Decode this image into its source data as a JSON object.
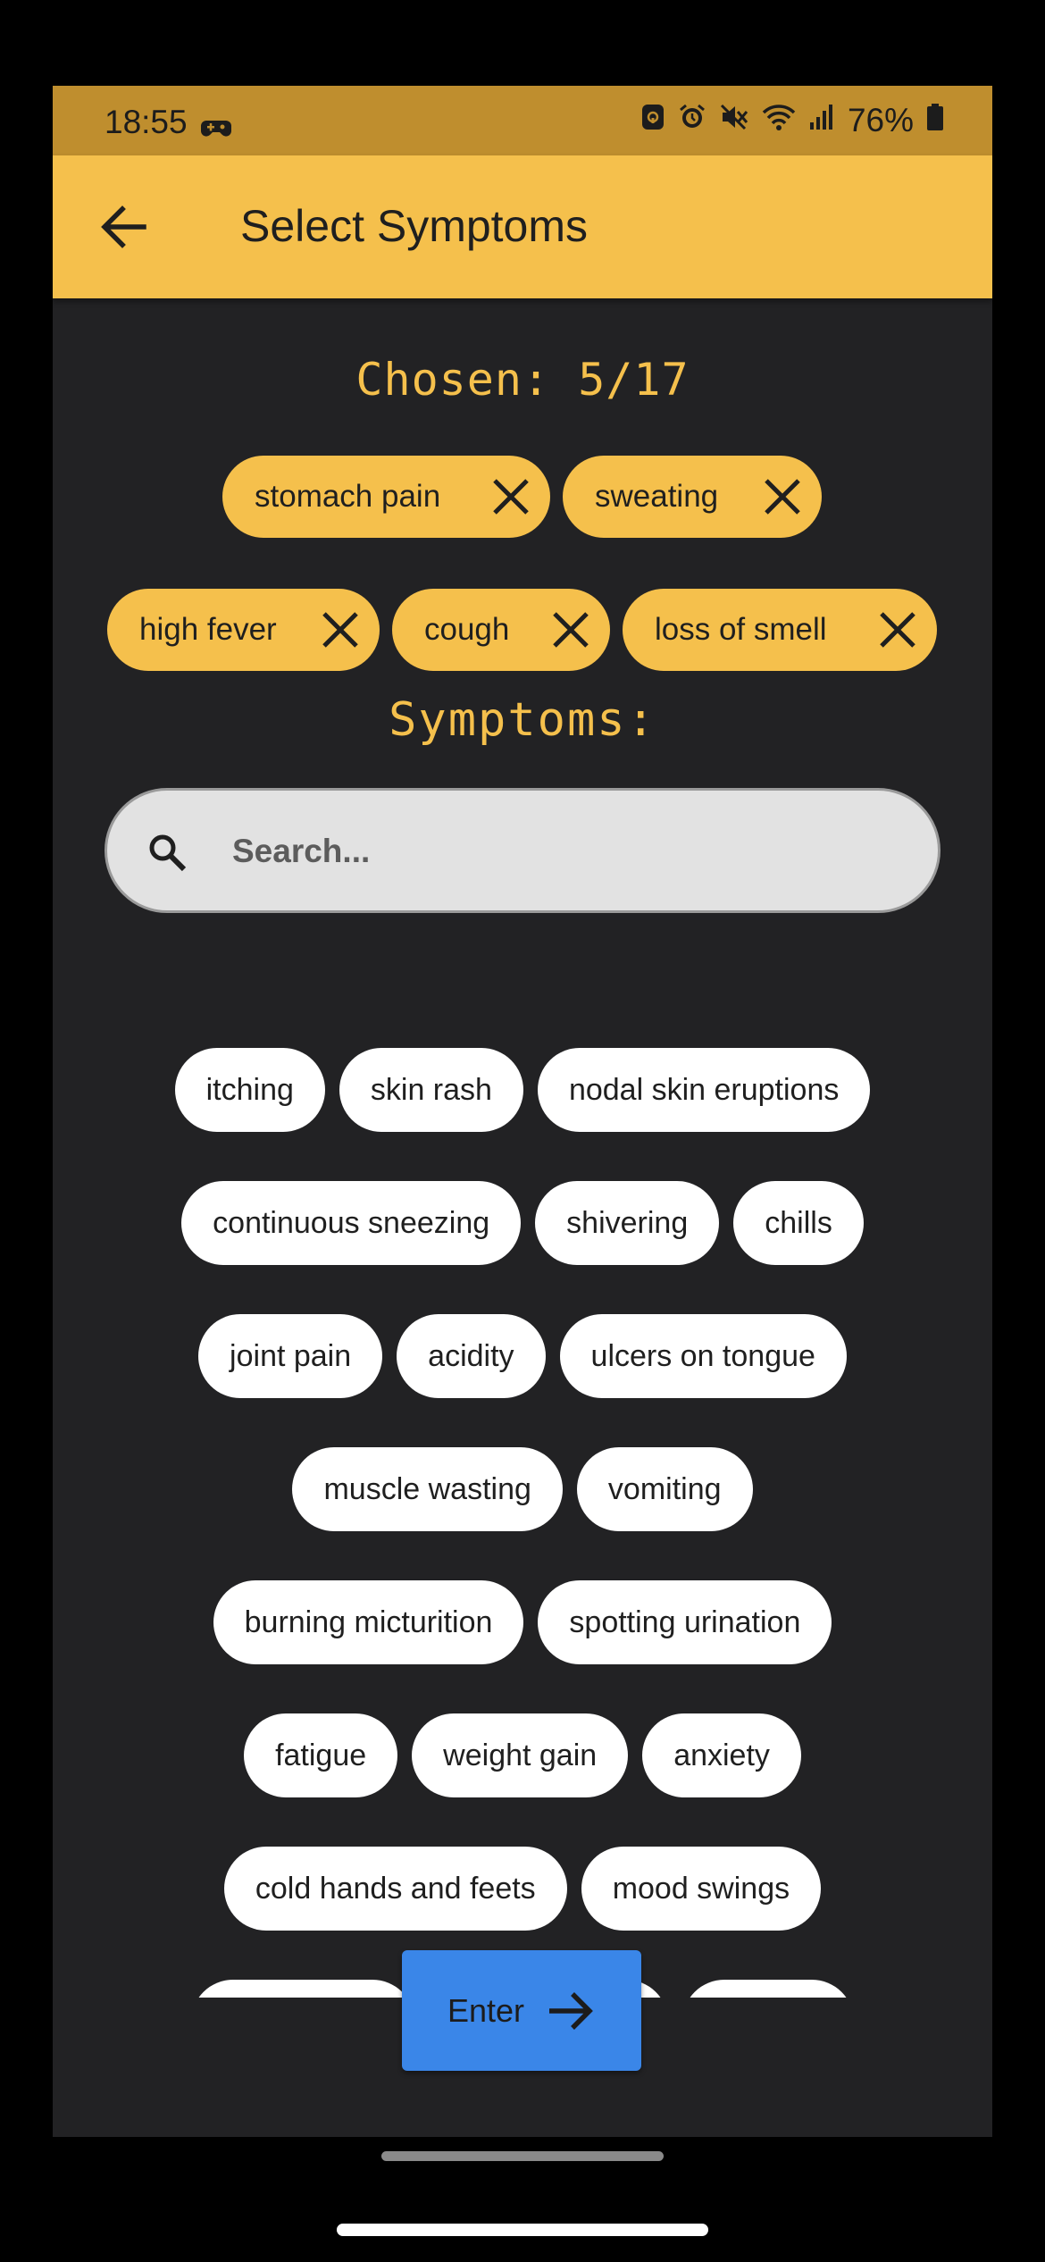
{
  "status_bar": {
    "time": "18:55",
    "battery": "76%",
    "icons": [
      "game-controller-icon",
      "lock-icon",
      "alarm-icon",
      "mute-icon",
      "wifi-icon",
      "signal-icon",
      "battery-icon"
    ]
  },
  "app_bar": {
    "title": "Select Symptoms",
    "back_icon": "arrow-left-icon"
  },
  "chosen": {
    "label": "Chosen: 5/17",
    "items": [
      "stomach pain",
      "sweating",
      "high fever",
      "cough",
      "loss of smell"
    ]
  },
  "symptoms": {
    "title": "Symptoms:",
    "search_placeholder": "Search...",
    "rows": [
      [
        "itching",
        "skin rash",
        "nodal skin eruptions"
      ],
      [
        "continuous sneezing",
        "shivering",
        "chills"
      ],
      [
        "joint pain",
        "acidity",
        "ulcers on tongue"
      ],
      [
        "muscle wasting",
        "vomiting"
      ],
      [
        "burning micturition",
        "spotting urination"
      ],
      [
        "fatigue",
        "weight gain",
        "anxiety"
      ],
      [
        "cold hands and feets",
        "mood swings"
      ]
    ]
  },
  "enter_button": {
    "label": "Enter",
    "icon": "arrow-right-icon"
  },
  "colors": {
    "accent": "#f5c04c",
    "status_bar": "#bf8e2e",
    "background": "#222224",
    "button": "#3a86e8"
  }
}
